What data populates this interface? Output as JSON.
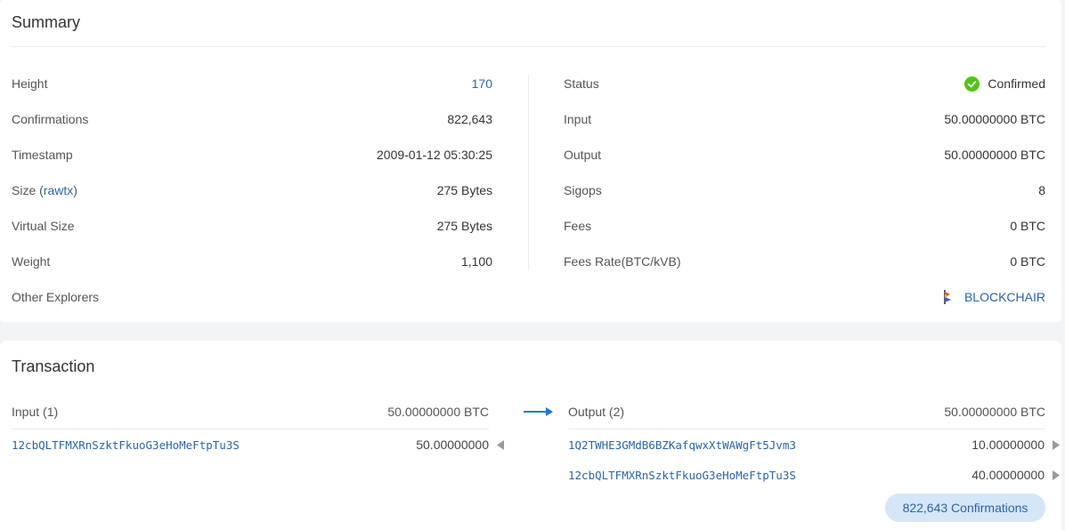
{
  "summary": {
    "title": "Summary",
    "left": [
      {
        "label": "Height",
        "value": "170",
        "link": true
      },
      {
        "label": "Confirmations",
        "value": "822,643"
      },
      {
        "label": "Timestamp",
        "value": "2009-01-12 05:30:25"
      },
      {
        "label_prefix": "Size (",
        "label_link": "rawtx",
        "label_suffix": ")",
        "value": "275 Bytes"
      },
      {
        "label": "Virtual Size",
        "value": "275 Bytes"
      },
      {
        "label": "Weight",
        "value": "1,100"
      }
    ],
    "right": [
      {
        "label": "Status",
        "value": "Confirmed",
        "icon": "check-circle-icon"
      },
      {
        "label": "Input",
        "value": "50.00000000 BTC"
      },
      {
        "label": "Output",
        "value": "50.00000000 BTC"
      },
      {
        "label": "Sigops",
        "value": "8"
      },
      {
        "label": "Fees",
        "value": "0 BTC"
      },
      {
        "label": "Fees Rate(BTC/kVB)",
        "value": "0 BTC"
      }
    ],
    "other_explorers": {
      "label": "Other Explorers",
      "link": "BLOCKCHAIR",
      "icon": "blockchair-logo-icon"
    }
  },
  "transaction": {
    "title": "Transaction",
    "input_label": "Input (1)",
    "input_total": "50.00000000 BTC",
    "output_label": "Output (2)",
    "output_total": "50.00000000 BTC",
    "inputs": [
      {
        "address": "12cbQLTFMXRnSzktFkuoG3eHoMeFtpTu3S",
        "amount": "50.00000000"
      }
    ],
    "outputs": [
      {
        "address": "1Q2TWHE3GMdB6BZKafqwxXtWAWgFt5Jvm3",
        "amount": "10.00000000"
      },
      {
        "address": "12cbQLTFMXRnSzktFkuoG3eHoMeFtpTu3S",
        "amount": "40.00000000"
      }
    ],
    "confirmations_badge": "822,643 Confirmations"
  },
  "colors": {
    "link": "#2a65a8",
    "confirmed": "#52c41a",
    "arrow": "#1f78d1",
    "badge_bg": "#d5e6f8"
  }
}
